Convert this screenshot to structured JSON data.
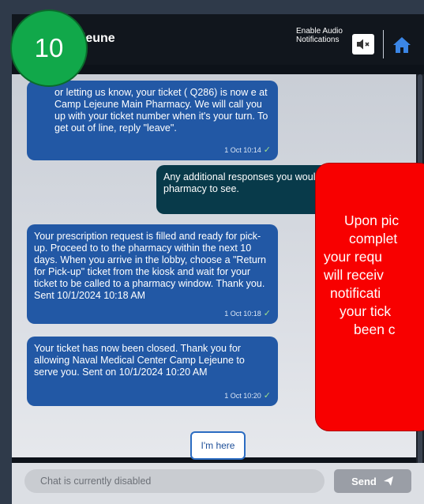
{
  "step_badge": "10",
  "header": {
    "title": "ejeune",
    "audio_label": "Enable Audio Notifications",
    "mute_icon": "speaker-mute-icon",
    "home_icon": "home-icon"
  },
  "messages": [
    {
      "direction": "in",
      "text": "or letting us know, your ticket ( Q286) is now e at Camp Lejeune Main Pharmacy. We will call you up with your ticket number when it's your turn. To get out of line, reply \"leave\".",
      "time": "1 Oct 10:14"
    },
    {
      "direction": "out",
      "text": "Any additional responses you would pharmacy to see."
    },
    {
      "direction": "in",
      "text": "Your prescription request is filled and ready for pick-up. Proceed to to the pharmacy within the next 10 days. When you arrive in the lobby, choose a \"Return for Pick-up\" ticket from the kiosk and wait for your ticket to be called to a pharmacy window. Thank you. Sent 10/1/2024 10:18 AM",
      "time": "1 Oct 10:18"
    },
    {
      "direction": "in",
      "text": "Your ticket has now been closed. Thank you for allowing Naval Medical Center Camp Lejeune to serve you. Sent on 10/1/2024 10:20 AM",
      "time": "1 Oct 10:20"
    }
  ],
  "quick_reply": "I'm here",
  "input": {
    "placeholder": "Chat is currently disabled"
  },
  "send_label": "Send",
  "callout_lines": [
    "Upon pic",
    "complet",
    "your requ",
    "will receiv",
    "notificati",
    "your tick",
    "been c"
  ],
  "colors": {
    "incoming": "#2258a5",
    "outgoing": "#083a4a",
    "callout": "#f80000",
    "badge": "#11a84a"
  }
}
